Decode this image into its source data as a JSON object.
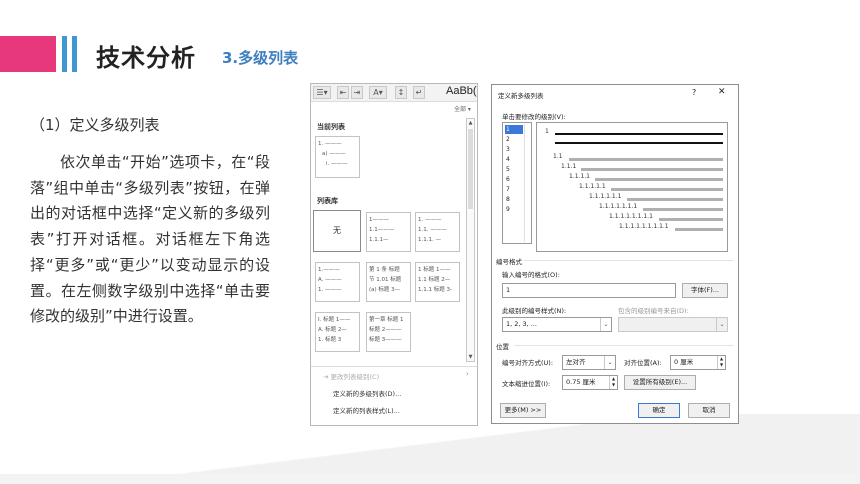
{
  "slide": {
    "title": "技术分析",
    "subtitle": "3.多级列表",
    "section_heading": "（1）定义多级列表",
    "paragraph": "依次单击“开始”选项卡，在“段落”组中单击“多级列表”按钮，在弹出的对话框中选择“定义新的多级列表”打开对话框。对话框左下角选择“更多”或“更少”以变动显示的设置。在左侧数字级别中选择“单击要修改的级别”中进行设置。"
  },
  "colors": {
    "accent_pink": "#e8387c",
    "accent_blue": "#3e96d3",
    "subtitle_blue": "#3e7fc0"
  },
  "gallery": {
    "style_preview": "AaBb(",
    "all_label": "全部 ▾",
    "current_list_heading": "当前列表",
    "current_list_sample": [
      "1. ———",
      "a) ———",
      "i. ———"
    ],
    "library_heading": "列表库",
    "none_label": "无",
    "library_samples": [
      [
        "1———",
        "1.1———",
        "1.1.1—"
      ],
      [
        "1. ———",
        "1.1. ———",
        "1.1.1. —"
      ],
      [
        "1.———",
        "A. ———",
        "1. ———"
      ],
      [
        "第 1 条 标题",
        "节 1.01 标题",
        "(a) 标题 3—"
      ],
      [
        "1 标题 1——",
        "1.1 标题 2—",
        "1.1.1 标题 3-"
      ],
      [
        "I. 标题 1——",
        "A. 标题 2—",
        "1. 标题 3"
      ],
      [
        "第一章 标题 1",
        "标题 2———",
        "标题 3———"
      ]
    ],
    "menu": {
      "change_level": "更改列表级别(C)",
      "define_list": "定义新的多级列表(D)...",
      "define_style": "定义新的列表样式(L)..."
    }
  },
  "dialog": {
    "title": "定义新多级列表",
    "help": "?",
    "close": "✕",
    "click_level_label": "单击要修改的级别(V):",
    "levels": [
      "1",
      "2",
      "3",
      "4",
      "5",
      "6",
      "7",
      "8",
      "9"
    ],
    "selected_level": "1",
    "preview_numbers": [
      "1",
      "1.1",
      "1.1.1",
      "1.1.1.1",
      "1.1.1.1.1",
      "1.1.1.1.1.1",
      "1.1.1.1.1.1.1",
      "1.1.1.1.1.1.1.1",
      "1.1.1.1.1.1.1.1.1"
    ],
    "number_format_group": "编号格式",
    "enter_format_label": "输入编号的格式(O):",
    "format_value": "1",
    "font_button": "字体(F)...",
    "style_label": "此级别的编号样式(N):",
    "style_value": "1, 2, 3, ...",
    "include_label": "包含的级别编号来自(D):",
    "position_group": "位置",
    "align_label": "编号对齐方式(U):",
    "align_value": "左对齐",
    "align_at_label": "对齐位置(A):",
    "align_at_value": "0 厘米",
    "indent_label": "文本缩进位置(I):",
    "indent_value": "0.75 厘米",
    "set_all_button": "设置所有级别(E)...",
    "more_button": "更多(M) >>",
    "ok_button": "确定",
    "cancel_button": "取消"
  }
}
